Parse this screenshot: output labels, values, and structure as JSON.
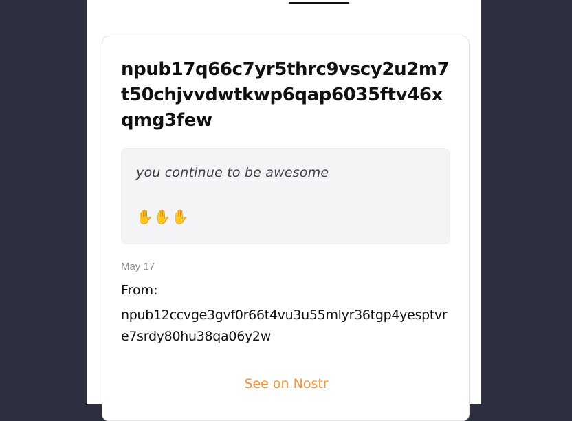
{
  "note": {
    "title_npub": "npub17q66c7yr5thrc9vscy2u2m7t50chjvvdwtkwp6qap6035ftv46xqmg3few",
    "message_text": "you continue to be awesome",
    "message_emoji": "✋✋✋",
    "date": "May 17",
    "from_label": "From:",
    "from_npub": "npub12ccvge3gvf0r66t4vu3u55mlyr36tgp4yesptvre7srdy80hu38qa06y2w",
    "link_label": "See on Nostr"
  },
  "colors": {
    "page_background": "#2b2f3f",
    "link": "#f0953e",
    "message_background": "#f4f4f6"
  }
}
